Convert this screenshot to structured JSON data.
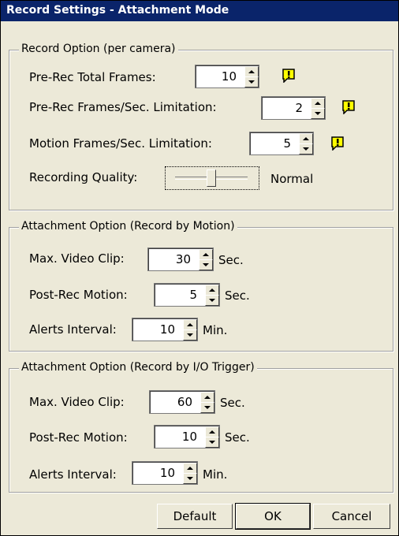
{
  "window": {
    "title": "Record Settings - Attachment Mode"
  },
  "record_option": {
    "legend": "Record Option (per camera)",
    "pre_rec_total_frames": {
      "label": "Pre-Rec Total Frames:",
      "value": "10"
    },
    "pre_rec_fps_limitation": {
      "label": "Pre-Rec Frames/Sec. Limitation:",
      "value": "2"
    },
    "motion_fps_limitation": {
      "label": "Motion Frames/Sec. Limitation:",
      "value": "5"
    },
    "recording_quality": {
      "label": "Recording Quality:",
      "value": "Normal",
      "level": 0.5
    }
  },
  "attachment_motion": {
    "legend": "Attachment Option (Record by Motion)",
    "max_video_clip": {
      "label": "Max. Video Clip:",
      "value": "30",
      "unit": "Sec."
    },
    "post_rec_motion": {
      "label": "Post-Rec Motion:",
      "value": "5",
      "unit": "Sec."
    },
    "alerts_interval": {
      "label": "Alerts Interval:",
      "value": "10",
      "unit": "Min."
    }
  },
  "attachment_io": {
    "legend": "Attachment Option (Record by I/O Trigger)",
    "max_video_clip": {
      "label": "Max. Video Clip:",
      "value": "60",
      "unit": "Sec."
    },
    "post_rec_motion": {
      "label": "Post-Rec Motion:",
      "value": "10",
      "unit": "Sec."
    },
    "alerts_interval": {
      "label": "Alerts Interval:",
      "value": "10",
      "unit": "Min."
    }
  },
  "buttons": {
    "default": "Default",
    "ok": "OK",
    "cancel": "Cancel"
  },
  "icons": {
    "warning": "warning-icon"
  },
  "colors": {
    "titlebar": "#0a246a",
    "warning": "#ffff00"
  }
}
